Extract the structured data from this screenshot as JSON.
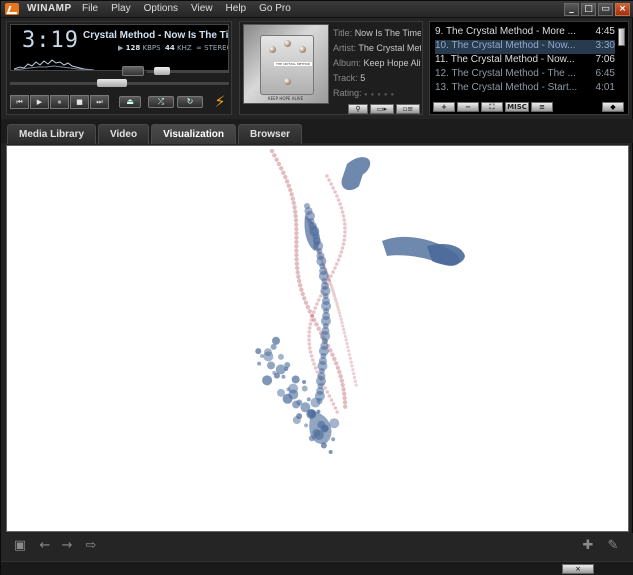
{
  "app": {
    "title": "WINAMP",
    "menu": [
      "File",
      "Play",
      "Options",
      "View",
      "Help",
      "Go Pro"
    ],
    "window_buttons": [
      "_",
      "□",
      "▭",
      "×"
    ]
  },
  "player": {
    "time": "3:19",
    "scrolling_title": "Crystal Method - Now Is The Time",
    "bitrate": "128",
    "bitrate_unit": "KBPS",
    "samplerate": "44",
    "samplerate_unit": "KHZ",
    "stereo": "STEREO",
    "seek_progress": 0.46,
    "volume_level": 0.1
  },
  "metadata": {
    "title_label": "Title:",
    "title_value": "Now Is The Time",
    "artist_label": "Artist:",
    "artist_value": "The Crystal Method",
    "album_label": "Album:",
    "album_value": "Keep Hope Alive",
    "track_label": "Track:",
    "track_value": "5",
    "rating_label": "Rating:",
    "album_art_label": "THE CRYSTAL METHOD",
    "album_art_caption": "KEEP HOPE ALIVE"
  },
  "playlist": {
    "items": [
      {
        "title": "9. The Crystal Method - More ...",
        "duration": "4:45",
        "state": "normal"
      },
      {
        "title": "10. The Crystal Method - Now...",
        "duration": "3:30",
        "state": "selected"
      },
      {
        "title": "11. The Crystal Method - Now...",
        "duration": "7:06",
        "state": "normal"
      },
      {
        "title": "12. The Crystal Method - The ...",
        "duration": "6:45",
        "state": "dim"
      },
      {
        "title": "13. The Crystal Method - Start...",
        "duration": "4:01",
        "state": "dim"
      }
    ],
    "toolbar": [
      "+",
      "−",
      "⛶",
      "MISC",
      "≡"
    ]
  },
  "tabs": [
    {
      "label": "Media Library",
      "active": false
    },
    {
      "label": "Video",
      "active": false
    },
    {
      "label": "Visualization",
      "active": true
    },
    {
      "label": "Browser",
      "active": false
    }
  ],
  "colors": {
    "accent": "#e8741c",
    "viz_blue": "#4a6a9a",
    "viz_red": "#b04050"
  }
}
